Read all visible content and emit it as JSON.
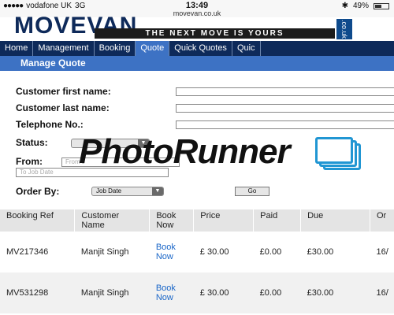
{
  "status_bar": {
    "carrier": "vodafone UK",
    "network": "3G",
    "time": "13:49",
    "url": "movevan.co.uk",
    "battery": "49%",
    "battery_level": 0.49
  },
  "brand": {
    "logo_word": "MOVEVAN",
    "tagline": "THE NEXT MOVE IS YOURS",
    "domain_suffix": ".co.uk",
    "colors": {
      "navy": "#0e2a5a",
      "accent_blue": "#3d72c4",
      "link_blue": "#1a66c8"
    }
  },
  "nav": {
    "items": [
      {
        "label": "Home"
      },
      {
        "label": "Management"
      },
      {
        "label": "Booking"
      },
      {
        "label": "Quote"
      },
      {
        "label": "Quick Quotes"
      },
      {
        "label": "Quic"
      }
    ],
    "active": "Quote"
  },
  "section": {
    "title": "Manage Quote"
  },
  "form": {
    "first_name_label": "Customer first name:",
    "last_name_label": "Customer last name:",
    "telephone_label": "Telephone No.:",
    "status_label": "Status:",
    "status_value": "",
    "from_label": "From:",
    "from_placeholder": "From J",
    "to_placeholder": "To Job Date",
    "order_label": "Order By:",
    "order_value": "Job Date",
    "go_label": "Go"
  },
  "watermark": {
    "text": "PhotoRunner",
    "icon": "stacked-frames-icon"
  },
  "table": {
    "headers": [
      "Booking Ref",
      "Customer Name",
      "Book Now",
      "Price",
      "Paid",
      "Due",
      "Or"
    ],
    "rows": [
      {
        "ref": "MV217346",
        "name": "Manjit Singh",
        "book": "Book Now",
        "price": "£ 30.00",
        "paid": "£0.00",
        "due": "£30.00",
        "order": "16/"
      },
      {
        "ref": "MV531298",
        "name": "Manjit Singh",
        "book": "Book Now",
        "price": "£ 30.00",
        "paid": "£0.00",
        "due": "£30.00",
        "order": "16/"
      }
    ]
  }
}
